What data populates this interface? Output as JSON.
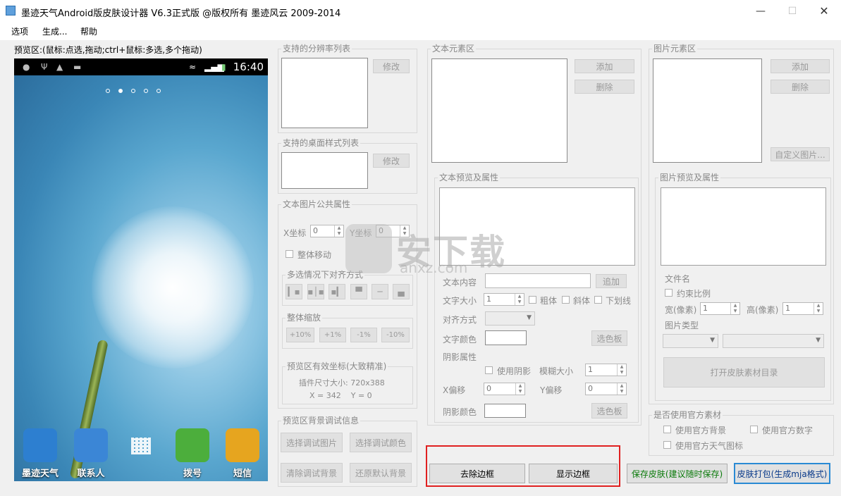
{
  "window": {
    "title": "墨迹天气Android版皮肤设计器 V6.3正式版 @版权所有 墨迹风云 2009-2014"
  },
  "menu": {
    "items": [
      "选项",
      "生成...",
      "帮助"
    ]
  },
  "preview": {
    "label": "预览区:(鼠标:点选,拖动;ctrl+鼠标:多选,多个拖动)",
    "clock": "16:40",
    "dock": [
      {
        "label": "墨迹天气",
        "color": "#2d7fd0"
      },
      {
        "label": "联系人",
        "color": "#3b86d6"
      },
      {
        "label": "拨号",
        "color": "#4cae3c"
      },
      {
        "label": "短信",
        "color": "#e6a51f"
      }
    ]
  },
  "resolution": {
    "title": "支持的分辨率列表",
    "edit_label": "修改"
  },
  "desktop_style": {
    "title": "支持的桌面样式列表",
    "edit_label": "修改"
  },
  "common_props": {
    "title": "文本图片公共属性",
    "x_label": "X坐标",
    "x_value": "0",
    "y_label": "Y坐标",
    "y_value": "0",
    "move_all_label": "整体移动",
    "align_title": "多选情况下对齐方式",
    "zoom_title": "整体缩放",
    "zoom_buttons": [
      "+10%",
      "+1%",
      "-1%",
      "-10%"
    ],
    "coords_title": "预览区有效坐标(大致精准)",
    "plugin_size": "插件尺寸大小: 720x388",
    "coords_readout": "X = 342    Y = 0"
  },
  "bg_debug": {
    "title": "预览区背景调试信息",
    "buttons": [
      "选择调试图片",
      "选择调试颜色",
      "清除调试背景",
      "还原默认背景"
    ]
  },
  "text_elements": {
    "title": "文本元素区",
    "add_label": "添加",
    "delete_label": "删除",
    "props_title": "文本预览及属性",
    "content_label": "文本内容",
    "content_add": "追加",
    "size_label": "文字大小",
    "size_value": "1",
    "bold_label": "粗体",
    "italic_label": "斜体",
    "underline_label": "下划线",
    "align_label": "对齐方式",
    "color_label": "文字颜色",
    "palette_label": "选色板",
    "shadow_title": "阴影属性",
    "use_shadow_label": "使用阴影",
    "blur_label": "模糊大小",
    "blur_value": "1",
    "xoff_label": "X偏移",
    "xoff_value": "0",
    "yoff_label": "Y偏移",
    "yoff_value": "0",
    "shadow_color_label": "阴影颜色",
    "shadow_palette_label": "选色板"
  },
  "image_elements": {
    "title": "图片元素区",
    "add_label": "添加",
    "delete_label": "删除",
    "custom_label": "自定义图片...",
    "props_title": "图片预览及属性",
    "filename_label": "文件名",
    "ratio_label": "约束比例",
    "width_label": "宽(像素)",
    "width_value": "1",
    "height_label": "高(像素)",
    "height_value": "1",
    "type_label": "图片类型",
    "open_dir_label": "打开皮肤素材目录"
  },
  "official": {
    "title": "是否使用官方素材",
    "bg_label": "使用官方背景",
    "digits_label": "使用官方数字",
    "icons_label": "使用官方天气图标"
  },
  "bottom": {
    "remove_border": "去除边框",
    "show_border": "显示边框",
    "save_skin": "保存皮肤(建议随时保存)",
    "pack_skin": "皮肤打包(生成mja格式)",
    "save_color": "#0a7a0a",
    "pack_color": "#0a3a8a"
  },
  "watermark": {
    "big": "安下载",
    "small": "anxz.com"
  }
}
